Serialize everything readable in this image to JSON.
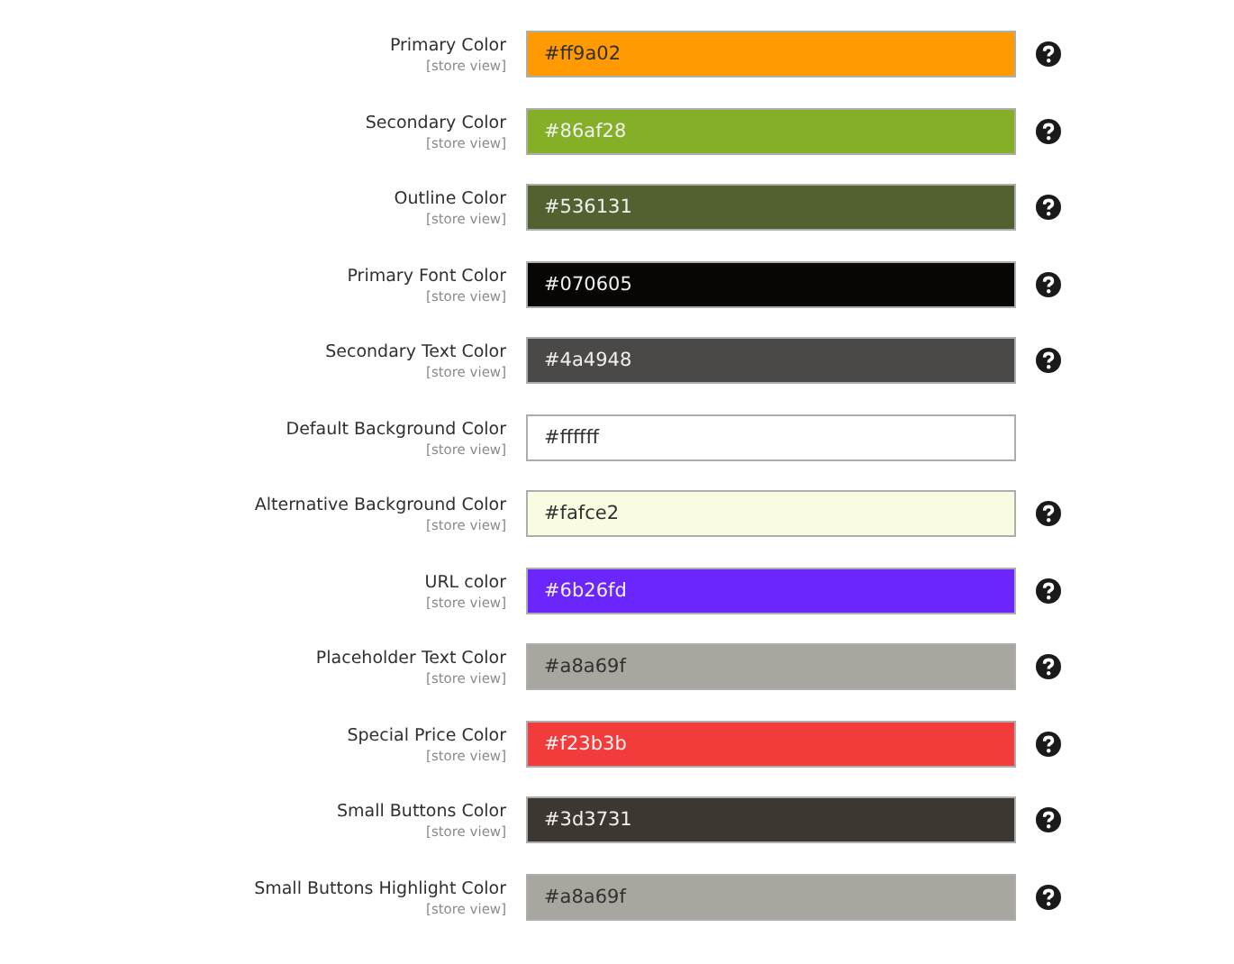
{
  "settings": [
    {
      "label": "Primary Color",
      "scope": "[store view]",
      "value": "#ff9a02",
      "color": "#ff9a02",
      "help": true
    },
    {
      "label": "Secondary Color",
      "scope": "[store view]",
      "value": "#86af28",
      "color": "#86af28",
      "help": true
    },
    {
      "label": "Outline Color",
      "scope": "[store view]",
      "value": "#536131",
      "color": "#536131",
      "help": true
    },
    {
      "label": "Primary Font Color",
      "scope": "[store view]",
      "value": "#070605",
      "color": "#070605",
      "help": true
    },
    {
      "label": "Secondary Text Color",
      "scope": "[store view]",
      "value": "#4a4948",
      "color": "#4a4948",
      "help": true
    },
    {
      "label": "Default Background Color",
      "scope": "[store view]",
      "value": "#ffffff",
      "color": "#ffffff",
      "help": false
    },
    {
      "label": "Alternative Background Color",
      "scope": "[store view]",
      "value": "#fafce2",
      "color": "#fafce2",
      "help": true
    },
    {
      "label": "URL color",
      "scope": "[store view]",
      "value": "#6b26fd",
      "color": "#6b26fd",
      "help": true
    },
    {
      "label": "Placeholder Text Color",
      "scope": "[store view]",
      "value": "#a8a69f",
      "color": "#a8a69f",
      "help": true
    },
    {
      "label": "Special Price Color",
      "scope": "[store view]",
      "value": "#f23b3b",
      "color": "#f23b3b",
      "help": true
    },
    {
      "label": "Small Buttons Color",
      "scope": "[store view]",
      "value": "#3d3731",
      "color": "#3d3731",
      "help": true
    },
    {
      "label": "Small Buttons Highlight Color",
      "scope": "[store view]",
      "value": "#a8a69f",
      "color": "#a8a69f",
      "help": true
    }
  ]
}
